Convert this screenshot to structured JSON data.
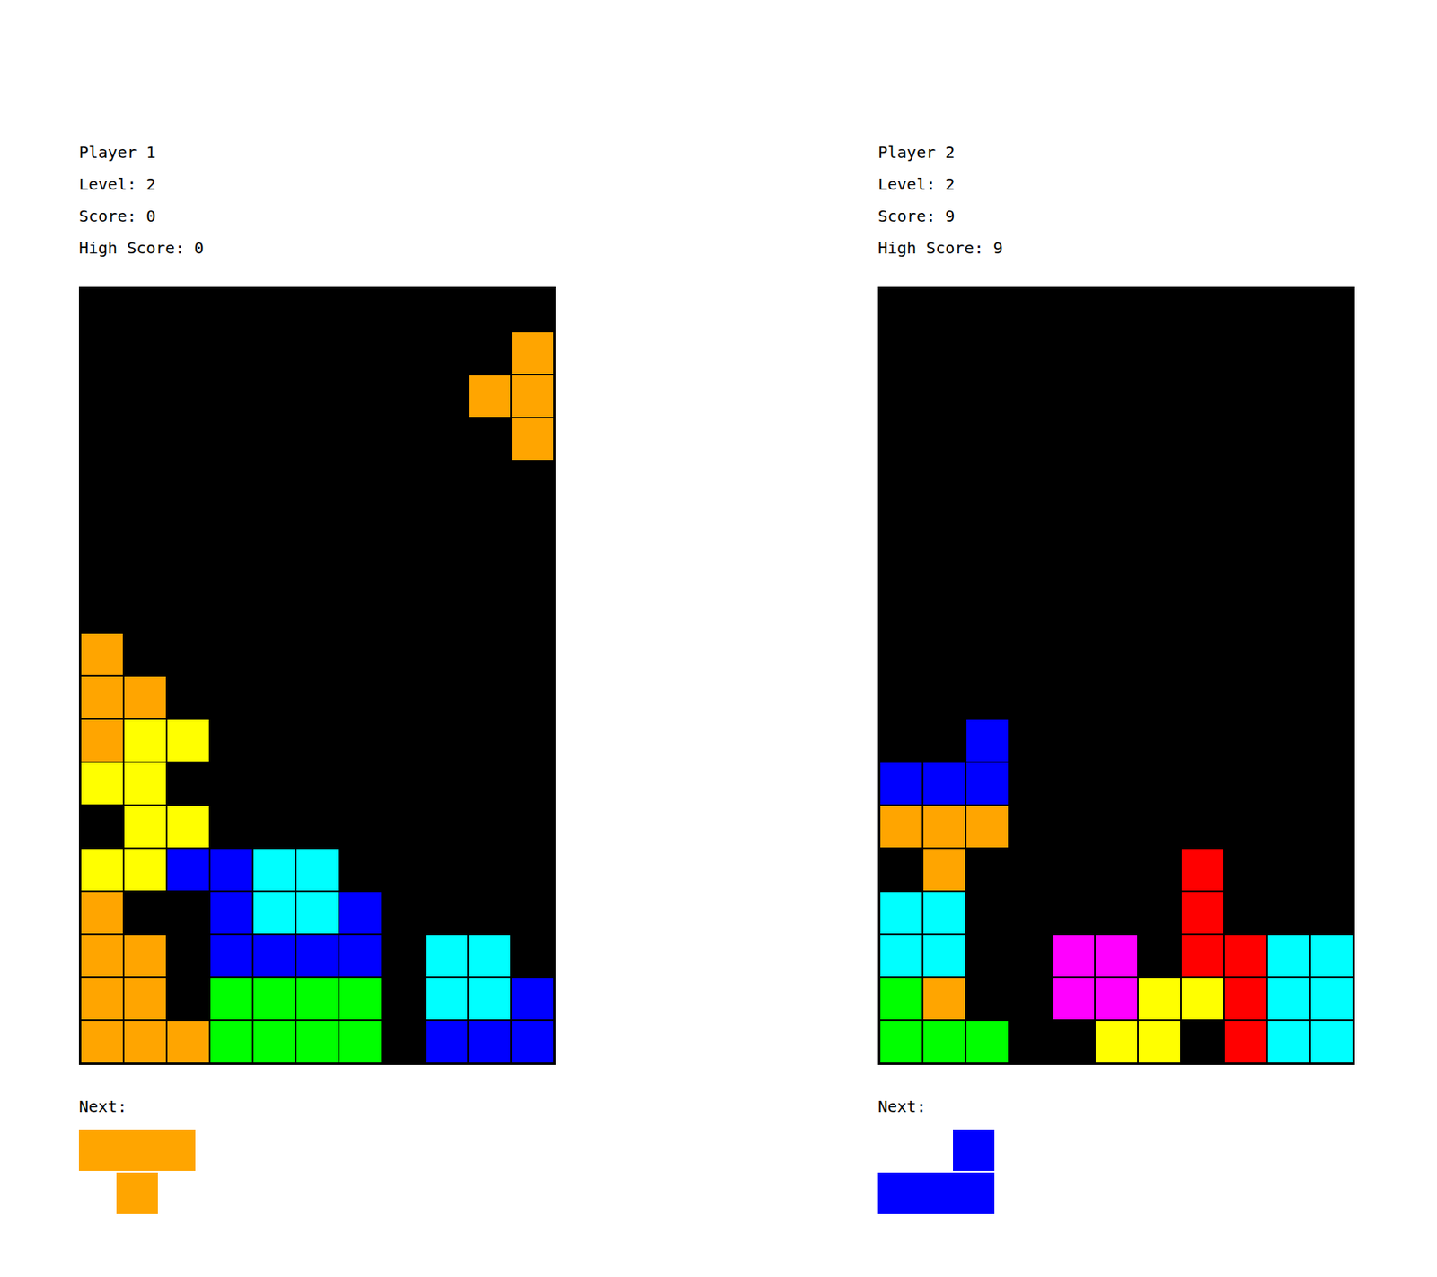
{
  "colors": {
    "O": "#ffa500",
    "Y": "#ffff00",
    "B": "#0000ff",
    "C": "#00ffff",
    "G": "#00ff00",
    "R": "#ff0000",
    "M": "#ff00ff"
  },
  "players": [
    {
      "title": "Player 1",
      "level": "Level: 2",
      "score": "Score: 0",
      "high_score": "High Score: 0",
      "next_label": "Next:",
      "board": [
        "...........",
        "..........O",
        ".........OO",
        "..........O",
        "...........",
        "...........",
        "...........",
        "...........",
        "O..........",
        "OO.........",
        "OYY........",
        "YY.........",
        ".YY........",
        "YYBBCC.....",
        "O..BCCB....",
        "OO.BBBB.CC.",
        "OO.GGGG.CCB",
        "OOOGGGG.BBB"
      ],
      "next": [
        "OOO",
        ".O."
      ]
    },
    {
      "title": "Player 2",
      "level": "Level: 2",
      "score": "Score: 9",
      "high_score": "High Score: 9",
      "next_label": "Next:",
      "board": [
        "...........",
        "...........",
        "...........",
        "...........",
        "...........",
        "...........",
        "...........",
        "...........",
        "...........",
        "...........",
        "..B........",
        "BBB........",
        "OOO........",
        ".O.....R...",
        "CC.....R...",
        "CC..MM.RRCC",
        "GO..MMYYRCC",
        "GGG..YY.RCC"
      ],
      "next": [
        "..B",
        "BBB"
      ]
    }
  ]
}
